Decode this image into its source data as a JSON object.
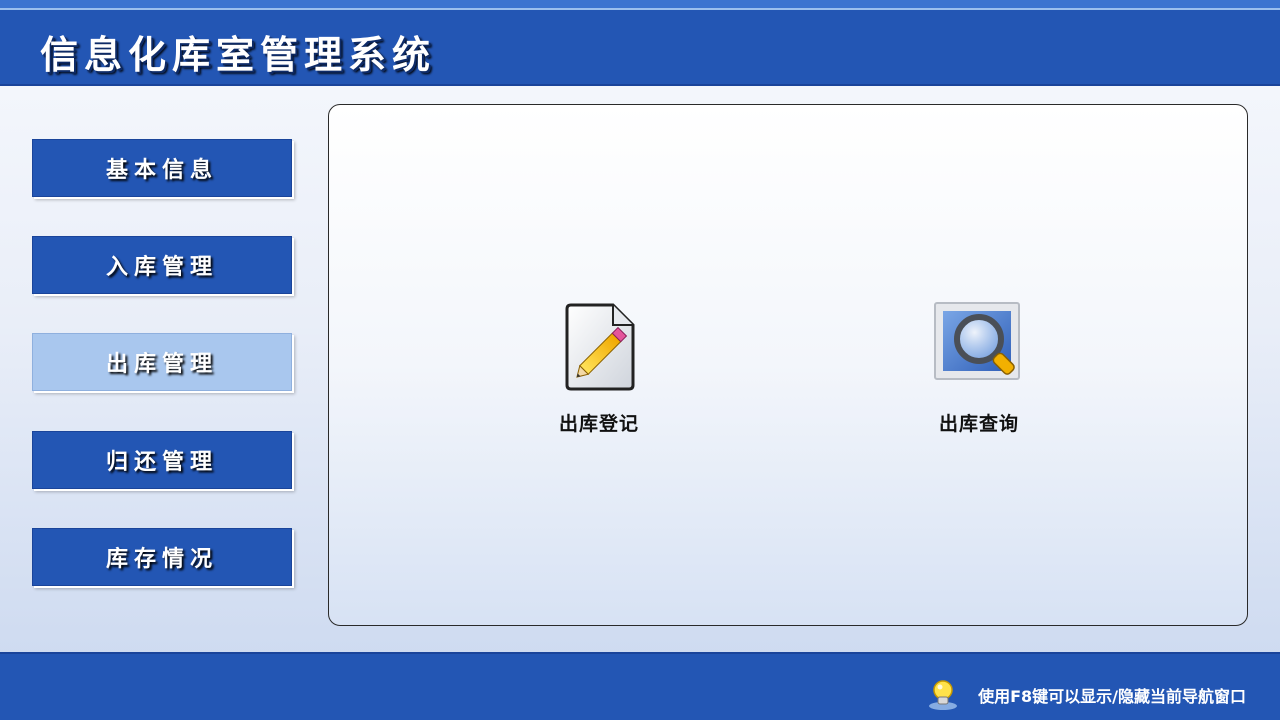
{
  "header": {
    "title": "信息化库室管理系统"
  },
  "sidebar": {
    "items": [
      {
        "label": "基本信息",
        "active": false
      },
      {
        "label": "入库管理",
        "active": false
      },
      {
        "label": "出库管理",
        "active": true
      },
      {
        "label": "归还管理",
        "active": false
      },
      {
        "label": "库存情况",
        "active": false
      }
    ]
  },
  "main": {
    "tiles": [
      {
        "label": "出库登记",
        "icon": "edit-document-icon"
      },
      {
        "label": "出库查询",
        "icon": "magnifier-search-icon"
      }
    ]
  },
  "footer": {
    "hint": "使用F8键可以显示/隐藏当前导航窗口",
    "hint_icon": "lightbulb-icon"
  },
  "colors": {
    "primary_blue": "#2356b4",
    "active_nav": "#a9c7ee",
    "panel_border": "#2a2a2a"
  }
}
